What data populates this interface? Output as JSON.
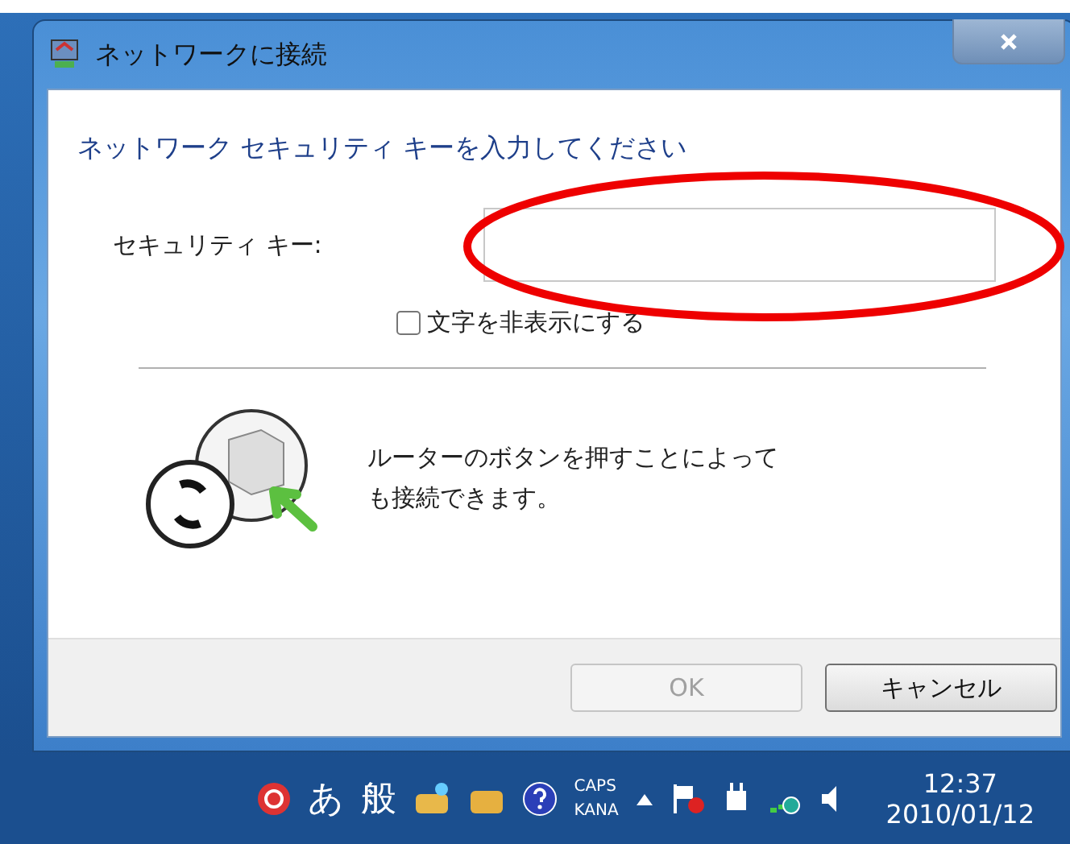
{
  "window": {
    "title": "ネットワークに接続"
  },
  "heading": "ネットワーク セキュリティ キーを入力してください",
  "security_key": {
    "label": "セキュリティ キー:"
  },
  "hide_characters": {
    "label": "文字を非表示にする",
    "checked": false
  },
  "router_hint": [
    "ルーターのボタンを押すことによって",
    "も接続できます。"
  ],
  "buttons": [
    {
      "label": "OK",
      "disabled": true
    },
    {
      "label": "キャンセル",
      "disabled": false
    }
  ],
  "taskbar": {
    "ime_mode": "あ",
    "ime_dictionary": "般",
    "caps": "CAPS",
    "kana": "KANA",
    "time": "12:37",
    "date": "2010/01/12"
  }
}
